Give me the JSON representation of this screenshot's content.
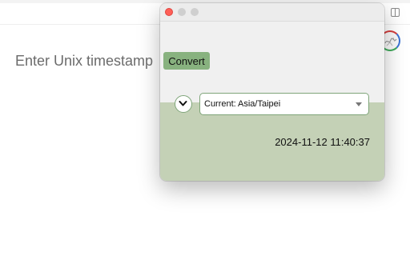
{
  "browser": {
    "sidebar_icon": "sidebar-panel-icon",
    "extension_icon": "extension-avatar-icon"
  },
  "popup": {
    "timestamp_input": {
      "placeholder": "Enter Unix timestamp",
      "value": ""
    },
    "convert_label": "Convert",
    "expand_icon": "chevron-down-icon",
    "timezone": {
      "label": "Current:",
      "value": "Asia/Taipei"
    },
    "result": "2024-11-12 11:40:37",
    "colors": {
      "accent": "#88b27f",
      "bottom_panel": "#c4d1b6",
      "close_light": "#fe5f57"
    }
  }
}
